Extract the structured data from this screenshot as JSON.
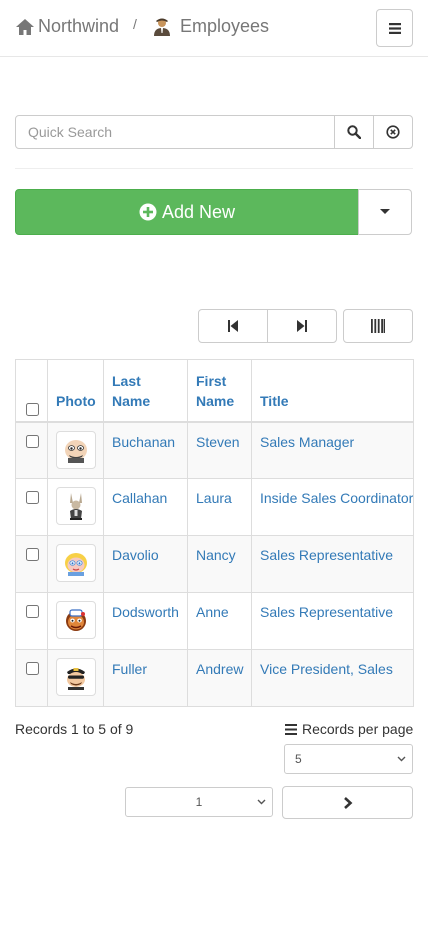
{
  "navbar": {
    "home_label": "Northwind",
    "separator": "/",
    "page_label": "Employees",
    "home_icon": "home-icon",
    "page_icon": "person-icon",
    "menu_icon": "hamburger-icon"
  },
  "search": {
    "placeholder": "Quick Search",
    "value": ""
  },
  "actions": {
    "add_label": "Add New",
    "accent_color": "#5cb85c"
  },
  "table": {
    "columns": [
      "Photo",
      "Last Name",
      "First Name",
      "Title"
    ],
    "rows": [
      {
        "last": "Buchanan",
        "first": "Steven",
        "title": "Sales Manager",
        "photo": "emoji-avatar-bald"
      },
      {
        "last": "Callahan",
        "first": "Laura",
        "title": "Inside Sales Coordinator",
        "photo": "emoji-avatar-bunny"
      },
      {
        "last": "Davolio",
        "first": "Nancy",
        "title": "Sales Representative",
        "photo": "emoji-avatar-blonde"
      },
      {
        "last": "Dodsworth",
        "first": "Anne",
        "title": "Sales Representative",
        "photo": "emoji-avatar-headset"
      },
      {
        "last": "Fuller",
        "first": "Andrew",
        "title": "Vice President, Sales",
        "photo": "emoji-avatar-captain"
      }
    ],
    "link_color": "#337ab7"
  },
  "footer": {
    "records_text": "Records 1 to 5 of 9",
    "per_page_label": "Records per page",
    "per_page_value": "5",
    "page_value": "1"
  }
}
